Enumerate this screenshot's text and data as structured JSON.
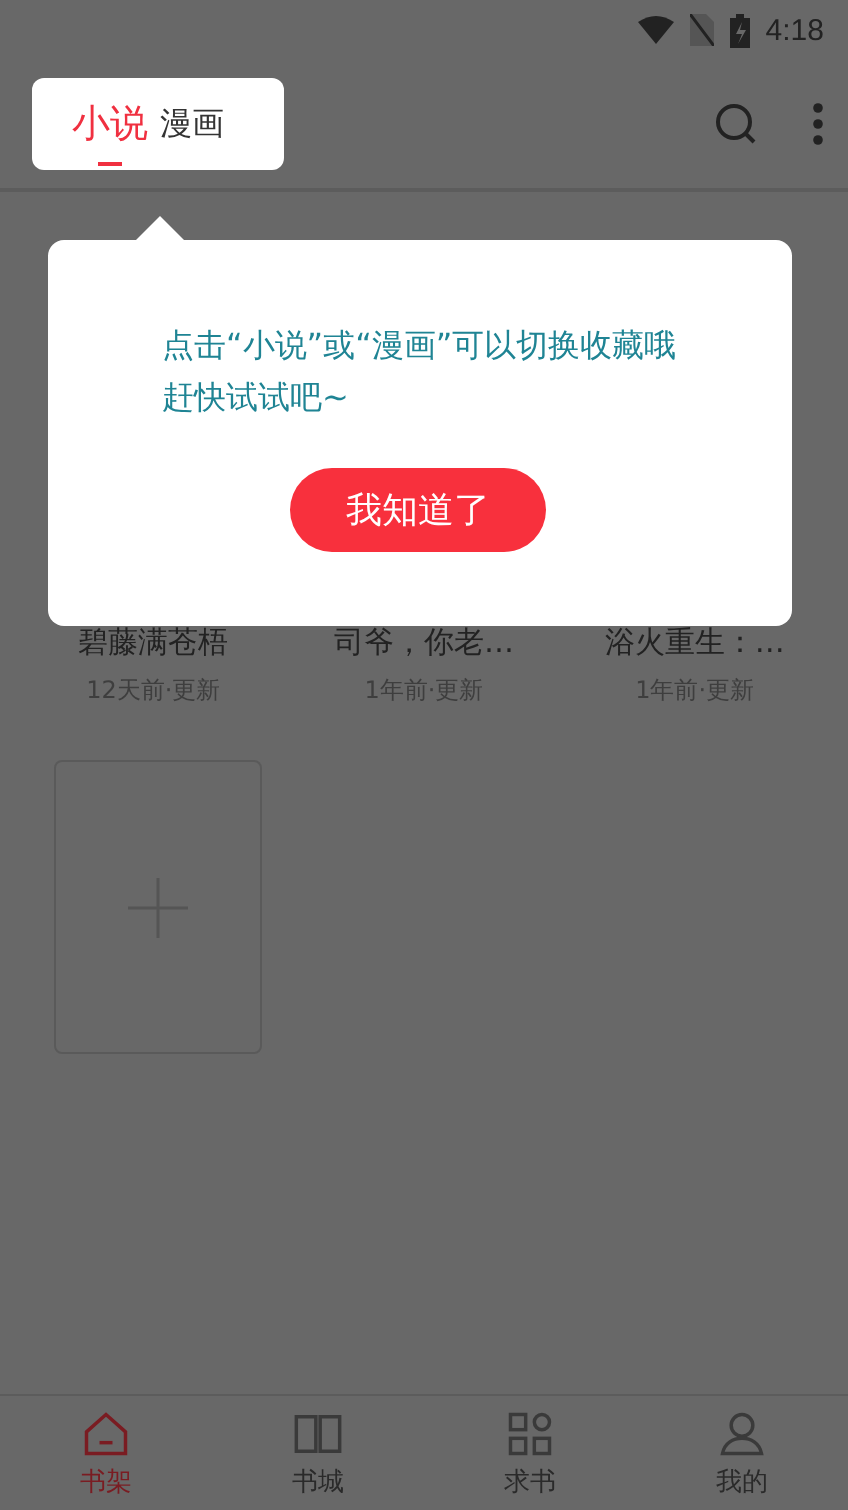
{
  "status_bar": {
    "time": "4:18"
  },
  "header": {
    "tabs": [
      {
        "label": "小说",
        "selected": true
      },
      {
        "label": "漫画",
        "selected": false
      }
    ]
  },
  "books": [
    {
      "title": "碧藤满苍梧",
      "updated": "12天前·更新"
    },
    {
      "title": "司爷，你老…",
      "updated": "1年前·更新"
    },
    {
      "title": "浴火重生：…",
      "updated": "1年前·更新"
    }
  ],
  "tip": {
    "message": "点击“小说”或“漫画”可以切换收藏哦赶快试试吧~",
    "button": "我知道了"
  },
  "nav": [
    {
      "label": "书架",
      "kind": "home",
      "selected": true
    },
    {
      "label": "书城",
      "kind": "book",
      "selected": false
    },
    {
      "label": "求书",
      "kind": "grid",
      "selected": false
    },
    {
      "label": "我的",
      "kind": "user",
      "selected": false
    }
  ]
}
